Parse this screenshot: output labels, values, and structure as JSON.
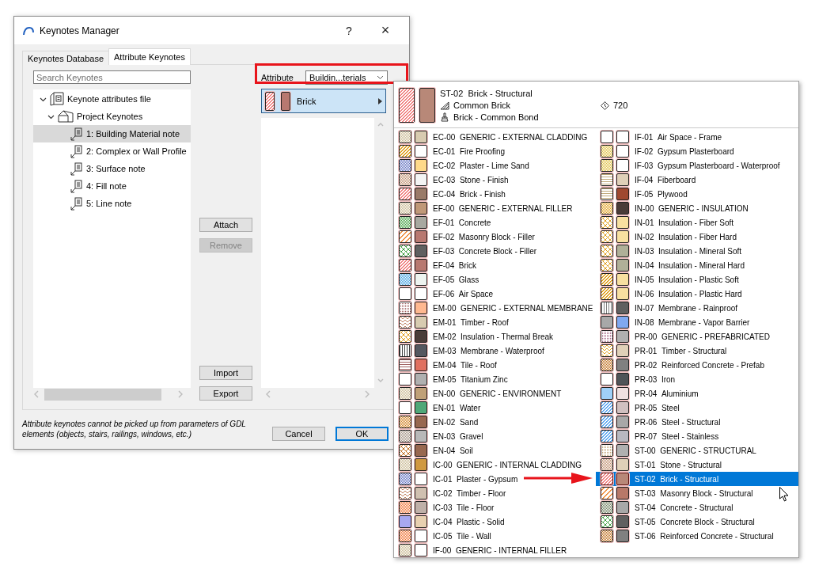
{
  "window": {
    "title": "Keynotes Manager",
    "help": "?",
    "close": "×"
  },
  "tabs": [
    {
      "label": "Keynotes Database",
      "selected": false
    },
    {
      "label": "Attribute Keynotes",
      "selected": true
    }
  ],
  "search": {
    "placeholder": "Search Keynotes"
  },
  "tree": [
    {
      "label": "Keynote attributes file",
      "kind": "file",
      "expanded": true,
      "children": [
        {
          "label": "Project Keynotes",
          "kind": "folder",
          "expanded": true,
          "children": [
            {
              "label": "1: Building Material note",
              "kind": "note",
              "selected": true
            },
            {
              "label": "2: Complex or Wall Profile",
              "kind": "note",
              "selected": false
            },
            {
              "label": "3: Surface note",
              "kind": "note",
              "selected": false
            },
            {
              "label": "4: Fill note",
              "kind": "note",
              "selected": false
            },
            {
              "label": "5: Line note",
              "kind": "note",
              "selected": false
            }
          ]
        }
      ]
    }
  ],
  "list_buttons": [
    {
      "label": "Attach",
      "disabled": false
    },
    {
      "label": "Remove",
      "disabled": true
    }
  ],
  "file_buttons": [
    {
      "label": "Import",
      "disabled": false
    },
    {
      "label": "Export",
      "disabled": false
    }
  ],
  "attribute": {
    "label": "Attribute",
    "value": "Buildin...terials"
  },
  "category": {
    "name": "Brick",
    "selected": true,
    "swatches": [
      {
        "kind": "diagonal",
        "color": "#f08080"
      },
      {
        "kind": "solid",
        "color": "#b87870"
      }
    ]
  },
  "note": "Attribute keynotes cannot be picked up from parameters of GDL elements (objects, stairs, railings, windows, etc.)",
  "dialog_buttons": [
    {
      "label": "Cancel",
      "default": false
    },
    {
      "label": "OK",
      "default": true
    }
  ],
  "popup": {
    "header": {
      "code": "ST-02",
      "name": "Brick - Structural",
      "fill": "Common Brick",
      "surface": "Brick - Common Bond",
      "value": "720",
      "swatches": [
        {
          "kind": "diagonal",
          "color": "#f08080"
        },
        {
          "kind": "solid",
          "color": "#b88878"
        }
      ]
    },
    "columns": [
      {
        "items": [
          {
            "code": "EC-00",
            "name": "GENERIC - EXTERNAL CLADDING",
            "swatches": [
              {
                "kind": "dots",
                "color": "#c8b890"
              },
              {
                "kind": "solid",
                "color": "#d8cbb0"
              }
            ],
            "selected": false
          },
          {
            "code": "EC-01",
            "name": "Fire Proofing",
            "swatches": [
              {
                "kind": "diagonal",
                "color": "#e0a020"
              },
              {
                "kind": "solid",
                "color": "#ffffff"
              }
            ],
            "selected": false
          },
          {
            "code": "EC-02",
            "name": "Plaster - Lime Sand",
            "swatches": [
              {
                "kind": "dots",
                "color": "#6070c0"
              },
              {
                "kind": "solid",
                "color": "#ffd98a"
              }
            ],
            "selected": false
          },
          {
            "code": "EC-03",
            "name": "Stone - Finish",
            "swatches": [
              {
                "kind": "dots",
                "color": "#c09070"
              },
              {
                "kind": "solid",
                "color": "#f4f4f4"
              }
            ],
            "selected": false
          },
          {
            "code": "EC-04",
            "name": "Brick - Finish",
            "swatches": [
              {
                "kind": "diagonal",
                "color": "#f08080"
              },
              {
                "kind": "solid",
                "color": "#9a7a68"
              }
            ],
            "selected": false
          },
          {
            "code": "EF-00",
            "name": "GENERIC - EXTERNAL FILLER",
            "swatches": [
              {
                "kind": "dots",
                "color": "#c8b890"
              },
              {
                "kind": "solid",
                "color": "#c09878"
              }
            ],
            "selected": false
          },
          {
            "code": "EF-01",
            "name": "Concrete",
            "swatches": [
              {
                "kind": "dots",
                "color": "#40a040"
              },
              {
                "kind": "solid",
                "color": "#a8a8a0"
              }
            ],
            "selected": false
          },
          {
            "code": "EF-02",
            "name": "Masonry Block - Filler",
            "swatches": [
              {
                "kind": "sparse",
                "color": "#f09040"
              },
              {
                "kind": "solid",
                "color": "#b87870"
              }
            ],
            "selected": false
          },
          {
            "code": "EF-03",
            "name": "Concrete Block - Filler",
            "swatches": [
              {
                "kind": "cross",
                "color": "#40a040"
              },
              {
                "kind": "solid",
                "color": "#606060"
              }
            ],
            "selected": false
          },
          {
            "code": "EF-04",
            "name": "Brick",
            "swatches": [
              {
                "kind": "diagonal",
                "color": "#f08080"
              },
              {
                "kind": "solid",
                "color": "#b87870"
              }
            ],
            "selected": false
          },
          {
            "code": "EF-05",
            "name": "Glass",
            "swatches": [
              {
                "kind": "dots",
                "color": "#40a0e0"
              },
              {
                "kind": "solid",
                "color": "#eef4f0"
              }
            ],
            "selected": false
          },
          {
            "code": "EF-06",
            "name": "Air Space",
            "swatches": [
              {
                "kind": "solid",
                "color": "#ffffff"
              },
              {
                "kind": "solid",
                "color": "#ffffff"
              }
            ],
            "selected": false
          },
          {
            "code": "EM-00",
            "name": "GENERIC - EXTERNAL MEMBRANE",
            "swatches": [
              {
                "kind": "grid",
                "color": "#a06060"
              },
              {
                "kind": "solid",
                "color": "#ffb890"
              }
            ],
            "selected": false
          },
          {
            "code": "EM-01",
            "name": "Timber - Roof",
            "swatches": [
              {
                "kind": "wave",
                "color": "#c08060"
              },
              {
                "kind": "solid",
                "color": "#d8cbb0"
              }
            ],
            "selected": false
          },
          {
            "code": "EM-02",
            "name": "Insulation - Thermal Break",
            "swatches": [
              {
                "kind": "cross",
                "color": "#e0a020"
              },
              {
                "kind": "solid",
                "color": "#4a3c38"
              }
            ],
            "selected": false
          },
          {
            "code": "EM-03",
            "name": "Membrane - Waterproof",
            "swatches": [
              {
                "kind": "vertical",
                "color": "#404040"
              },
              {
                "kind": "solid",
                "color": "#555860"
              }
            ],
            "selected": false
          },
          {
            "code": "EM-04",
            "name": "Tile - Roof",
            "swatches": [
              {
                "kind": "horizontal",
                "color": "#a06060"
              },
              {
                "kind": "solid",
                "color": "#e07060"
              }
            ],
            "selected": false
          },
          {
            "code": "EM-05",
            "name": "Titanium Zinc",
            "swatches": [
              {
                "kind": "solid",
                "color": "#ffffff"
              },
              {
                "kind": "solid",
                "color": "#b0b0b0"
              }
            ],
            "selected": false
          },
          {
            "code": "EN-00",
            "name": "GENERIC - ENVIRONMENT",
            "swatches": [
              {
                "kind": "dots",
                "color": "#c8b890"
              },
              {
                "kind": "solid",
                "color": "#c0a078"
              }
            ],
            "selected": false
          },
          {
            "code": "EN-01",
            "name": "Water",
            "swatches": [
              {
                "kind": "solid",
                "color": "#ffffff"
              },
              {
                "kind": "solid",
                "color": "#50a878"
              }
            ],
            "selected": false
          },
          {
            "code": "EN-02",
            "name": "Sand",
            "swatches": [
              {
                "kind": "dots",
                "color": "#d08020"
              },
              {
                "kind": "solid",
                "color": "#986850"
              }
            ],
            "selected": false
          },
          {
            "code": "EN-03",
            "name": "Gravel",
            "swatches": [
              {
                "kind": "dots",
                "color": "#a09080"
              },
              {
                "kind": "solid",
                "color": "#b8b8b8"
              }
            ],
            "selected": false
          },
          {
            "code": "EN-04",
            "name": "Soil",
            "swatches": [
              {
                "kind": "cross",
                "color": "#c07020"
              },
              {
                "kind": "solid",
                "color": "#986850"
              }
            ],
            "selected": false
          },
          {
            "code": "IC-00",
            "name": "GENERIC - INTERNAL CLADDING",
            "swatches": [
              {
                "kind": "dots",
                "color": "#c8b890"
              },
              {
                "kind": "solid",
                "color": "#d09840"
              }
            ],
            "selected": false
          },
          {
            "code": "IC-01",
            "name": "Plaster - Gypsum",
            "swatches": [
              {
                "kind": "dots",
                "color": "#6070c0"
              },
              {
                "kind": "solid",
                "color": "#ffffff"
              }
            ],
            "selected": false
          },
          {
            "code": "IC-02",
            "name": "Timber - Floor",
            "swatches": [
              {
                "kind": "wave",
                "color": "#c08060"
              },
              {
                "kind": "solid",
                "color": "#d0c0b0"
              }
            ],
            "selected": false
          },
          {
            "code": "IC-03",
            "name": "Tile - Floor",
            "swatches": [
              {
                "kind": "dots",
                "color": "#f07030"
              },
              {
                "kind": "solid",
                "color": "#c0b0a8"
              }
            ],
            "selected": false
          },
          {
            "code": "IC-04",
            "name": "Plastic - Solid",
            "swatches": [
              {
                "kind": "solid",
                "color": "#a8a8f0"
              },
              {
                "kind": "solid",
                "color": "#e8d0b0"
              }
            ],
            "selected": false
          },
          {
            "code": "IC-05",
            "name": "Tile - Wall",
            "swatches": [
              {
                "kind": "dots",
                "color": "#f07030"
              },
              {
                "kind": "solid",
                "color": "#ffffff"
              }
            ],
            "selected": false
          },
          {
            "code": "IF-00",
            "name": "GENERIC - INTERNAL FILLER",
            "swatches": [
              {
                "kind": "dots",
                "color": "#c8b890"
              },
              {
                "kind": "solid",
                "color": "#ffffff"
              }
            ],
            "selected": false
          }
        ]
      },
      {
        "items": [
          {
            "code": "IF-01",
            "name": "Air Space - Frame",
            "swatches": [
              {
                "kind": "solid",
                "color": "#ffffff"
              },
              {
                "kind": "solid",
                "color": "#ffffff"
              }
            ],
            "selected": false
          },
          {
            "code": "IF-02",
            "name": "Gypsum Plasterboard",
            "swatches": [
              {
                "kind": "dots",
                "color": "#e0c040"
              },
              {
                "kind": "solid",
                "color": "#ffffff"
              }
            ],
            "selected": false
          },
          {
            "code": "IF-03",
            "name": "Gypsum Plasterboard - Waterproof",
            "swatches": [
              {
                "kind": "dots",
                "color": "#e0c040"
              },
              {
                "kind": "solid",
                "color": "#ffffff"
              }
            ],
            "selected": false
          },
          {
            "code": "IF-04",
            "name": "Fiberboard",
            "swatches": [
              {
                "kind": "horizontal",
                "color": "#c0a878"
              },
              {
                "kind": "solid",
                "color": "#e0d0b8"
              }
            ],
            "selected": false
          },
          {
            "code": "IF-05",
            "name": "Plywood",
            "swatches": [
              {
                "kind": "horizontal",
                "color": "#c0a878"
              },
              {
                "kind": "solid",
                "color": "#a04830"
              }
            ],
            "selected": false
          },
          {
            "code": "IN-00",
            "name": "GENERIC - INSULATION",
            "swatches": [
              {
                "kind": "dots",
                "color": "#e0a020"
              },
              {
                "kind": "solid",
                "color": "#4a3c38"
              }
            ],
            "selected": false
          },
          {
            "code": "IN-01",
            "name": "Insulation - Fiber Soft",
            "swatches": [
              {
                "kind": "cross",
                "color": "#e0a020"
              },
              {
                "kind": "solid",
                "color": "#f8e0a0"
              }
            ],
            "selected": false
          },
          {
            "code": "IN-02",
            "name": "Insulation - Fiber Hard",
            "swatches": [
              {
                "kind": "cross",
                "color": "#e0a020"
              },
              {
                "kind": "solid",
                "color": "#f8e0a0"
              }
            ],
            "selected": false
          },
          {
            "code": "IN-03",
            "name": "Insulation - Mineral Soft",
            "swatches": [
              {
                "kind": "cross",
                "color": "#e0a020"
              },
              {
                "kind": "solid",
                "color": "#b0b098"
              }
            ],
            "selected": false
          },
          {
            "code": "IN-04",
            "name": "Insulation - Mineral Hard",
            "swatches": [
              {
                "kind": "cross",
                "color": "#e0a020"
              },
              {
                "kind": "solid",
                "color": "#b0b098"
              }
            ],
            "selected": false
          },
          {
            "code": "IN-05",
            "name": "Insulation - Plastic Soft",
            "swatches": [
              {
                "kind": "diagonal",
                "color": "#e0a020"
              },
              {
                "kind": "solid",
                "color": "#f8e0a0"
              }
            ],
            "selected": false
          },
          {
            "code": "IN-06",
            "name": "Insulation - Plastic Hard",
            "swatches": [
              {
                "kind": "diagonal",
                "color": "#e0a020"
              },
              {
                "kind": "solid",
                "color": "#f8e0a0"
              }
            ],
            "selected": false
          },
          {
            "code": "IN-07",
            "name": "Membrane - Rainproof",
            "swatches": [
              {
                "kind": "vertical",
                "color": "#808080"
              },
              {
                "kind": "solid",
                "color": "#606060"
              }
            ],
            "selected": false
          },
          {
            "code": "IN-08",
            "name": "Membrane - Vapor Barrier",
            "swatches": [
              {
                "kind": "solid",
                "color": "#a8a8a8"
              },
              {
                "kind": "solid",
                "color": "#80a8f0"
              }
            ],
            "selected": false
          },
          {
            "code": "PR-00",
            "name": "GENERIC - PREFABRICATED",
            "swatches": [
              {
                "kind": "grid",
                "color": "#a06080"
              },
              {
                "kind": "solid",
                "color": "#b0b0b0"
              }
            ],
            "selected": false
          },
          {
            "code": "PR-01",
            "name": "Timber - Structural",
            "swatches": [
              {
                "kind": "wave",
                "color": "#e0a020"
              },
              {
                "kind": "solid",
                "color": "#e0d0b8"
              }
            ],
            "selected": false
          },
          {
            "code": "PR-02",
            "name": "Reinforced Concrete - Prefab",
            "swatches": [
              {
                "kind": "dots",
                "color": "#c07020"
              },
              {
                "kind": "solid",
                "color": "#808080"
              }
            ],
            "selected": false
          },
          {
            "code": "PR-03",
            "name": "Iron",
            "swatches": [
              {
                "kind": "solid",
                "color": "#ffffff"
              },
              {
                "kind": "solid",
                "color": "#505458"
              }
            ],
            "selected": false
          },
          {
            "code": "PR-04",
            "name": "Aluminium",
            "swatches": [
              {
                "kind": "solid",
                "color": "#a0d0f8"
              },
              {
                "kind": "solid",
                "color": "#f0e0e0"
              }
            ],
            "selected": false
          },
          {
            "code": "PR-05",
            "name": "Steel",
            "swatches": [
              {
                "kind": "diagonal",
                "color": "#60a8f0"
              },
              {
                "kind": "solid",
                "color": "#d0c0c0"
              }
            ],
            "selected": false
          },
          {
            "code": "PR-06",
            "name": "Steel - Structural",
            "swatches": [
              {
                "kind": "diagonal",
                "color": "#60a8f0"
              },
              {
                "kind": "solid",
                "color": "#a8a8a8"
              }
            ],
            "selected": false
          },
          {
            "code": "PR-07",
            "name": "Steel - Stainless",
            "swatches": [
              {
                "kind": "diagonal",
                "color": "#60a8f0"
              },
              {
                "kind": "solid",
                "color": "#b8b8c0"
              }
            ],
            "selected": false
          },
          {
            "code": "ST-00",
            "name": "GENERIC - STRUCTURAL",
            "swatches": [
              {
                "kind": "grid",
                "color": "#c0a070"
              },
              {
                "kind": "solid",
                "color": "#b0b0b0"
              }
            ],
            "selected": false
          },
          {
            "code": "ST-01",
            "name": "Stone - Structural",
            "swatches": [
              {
                "kind": "dots",
                "color": "#c09070"
              },
              {
                "kind": "solid",
                "color": "#e0d0b8"
              }
            ],
            "selected": false
          },
          {
            "code": "ST-02",
            "name": "Brick - Structural",
            "swatches": [
              {
                "kind": "diagonal",
                "color": "#f08080"
              },
              {
                "kind": "solid",
                "color": "#b88878"
              }
            ],
            "selected": true
          },
          {
            "code": "ST-03",
            "name": "Masonry Block - Structural",
            "swatches": [
              {
                "kind": "sparse",
                "color": "#f09040"
              },
              {
                "kind": "solid",
                "color": "#b87868"
              }
            ],
            "selected": false
          },
          {
            "code": "ST-04",
            "name": "Concrete - Structural",
            "swatches": [
              {
                "kind": "dots",
                "color": "#708060"
              },
              {
                "kind": "solid",
                "color": "#a8a8a8"
              }
            ],
            "selected": false
          },
          {
            "code": "ST-05",
            "name": "Concrete Block - Structural",
            "swatches": [
              {
                "kind": "cross",
                "color": "#40a040"
              },
              {
                "kind": "solid",
                "color": "#606060"
              }
            ],
            "selected": false
          },
          {
            "code": "ST-06",
            "name": "Reinforced Concrete - Structural",
            "swatches": [
              {
                "kind": "dots",
                "color": "#c07020"
              },
              {
                "kind": "solid",
                "color": "#808080"
              }
            ],
            "selected": false
          }
        ]
      }
    ]
  }
}
